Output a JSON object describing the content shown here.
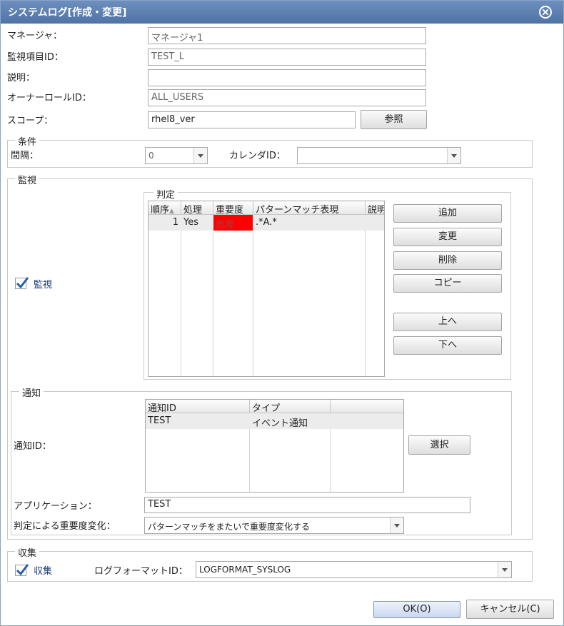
{
  "dialog": {
    "title": "システムログ[作成・変更]"
  },
  "form": {
    "manager_label": "マネージャ：",
    "manager_value": "マネージャ1",
    "monitor_id_label": "監視項目ID：",
    "monitor_id_value": "TEST_L",
    "description_label": "説明：",
    "description_value": "",
    "owner_role_label": "オーナーロールID：",
    "owner_role_value": "ALL_USERS",
    "scope_label": "スコープ：",
    "scope_value": "rhel8_ver",
    "browse_button": "参照"
  },
  "condition": {
    "legend": "条件",
    "interval_label": "間隔：",
    "interval_value": "0",
    "calendar_label": "カレンダID：",
    "calendar_value": ""
  },
  "monitor": {
    "legend": "監視",
    "checkbox_label": "監視",
    "checked": true,
    "judgment_legend": "判定",
    "columns": [
      "順序",
      "処理",
      "重要度",
      "パターンマッチ表現",
      "説明"
    ],
    "rows": [
      {
        "order": "1",
        "process": "Yes",
        "priority": "危険",
        "pattern": ".*A.*",
        "description": ""
      }
    ],
    "priority_color": "#ff0000",
    "buttons": {
      "add": "追加",
      "modify": "変更",
      "delete": "削除",
      "copy": "コピー",
      "up": "上へ",
      "down": "下へ"
    }
  },
  "notify": {
    "legend": "通知",
    "notify_id_label": "通知ID：",
    "columns": [
      "通知ID",
      "タイプ",
      ""
    ],
    "rows": [
      {
        "id": "TEST",
        "type": "イベント通知",
        "extra": ""
      }
    ],
    "select_button": "選択",
    "application_label": "アプリケーション：",
    "application_value": "TEST",
    "priority_change_label": "判定による重要度変化：",
    "priority_change_value": "パターンマッチをまたいで重要度変化する"
  },
  "collect": {
    "legend": "収集",
    "checkbox_label": "収集",
    "checked": true,
    "log_format_label": "ログフォーマットID：",
    "log_format_value": "LOGFORMAT_SYSLOG"
  },
  "footer": {
    "ok": "OK(O)",
    "cancel": "キャンセル(C)"
  },
  "colors": {
    "titlebar": "#5a7db0",
    "accent_check": "#2a5fa8"
  }
}
